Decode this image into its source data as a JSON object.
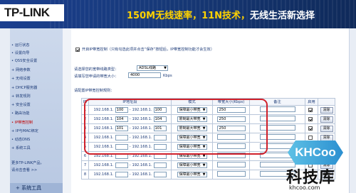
{
  "banner": {
    "brand": "TP-LINK",
    "tagline_speed": "150M无线速率，11N技术，",
    "tagline_rest": "无线生活新选择"
  },
  "sidebar": {
    "items": [
      {
        "label": "• 运行状态",
        "active": false
      },
      {
        "label": "• 设置向导",
        "active": false
      },
      {
        "label": "• QSS安全设置",
        "active": false
      },
      {
        "label": "+ 网络参数",
        "active": false
      },
      {
        "label": "+ 无线设置",
        "active": false
      },
      {
        "label": "+ DHCP服务器",
        "active": false
      },
      {
        "label": "+ 转发规则",
        "active": false
      },
      {
        "label": "+ 安全设置",
        "active": false
      },
      {
        "label": "• 路由功能",
        "active": false
      },
      {
        "label": "• IP带宽控制",
        "active": true
      },
      {
        "label": "+ IP与MAC绑定",
        "active": false
      },
      {
        "label": "• 动态DNS",
        "active": false
      },
      {
        "label": "+ 系统工具",
        "active": false
      }
    ],
    "more_1": "更多TP-LINK产品，",
    "more_2": "请点击查看 >>",
    "bottom_label": "+ 系统工具"
  },
  "main": {
    "enable_label": "开启IP带宽控制（只有勾选此项并点击“保存”按钮后，IP带宽控制功能才会生效）",
    "line_type_label": "请选择您的宽带线路类型：",
    "line_type_value": "ADSL线路",
    "bandwidth_label": "请填写您申请的带宽大小：",
    "bandwidth_value": "4000",
    "bandwidth_unit": "Kbps",
    "rules_label": "请配置IP带宽控制规则：",
    "columns": [
      "ID",
      "IP地址段",
      "模式",
      "带宽大小(Kbps)",
      "备注",
      "启用",
      ""
    ],
    "ip_prefix": "192.168.1.",
    "dash": "-",
    "clear_label": "清除",
    "rows": [
      {
        "id": "1",
        "start": "100",
        "end": "100",
        "mode": "保障最小带宽",
        "bw": "250",
        "enabled": true
      },
      {
        "id": "2",
        "start": "104",
        "end": "104",
        "mode": "限制最大带宽",
        "bw": "250",
        "enabled": true
      },
      {
        "id": "3",
        "start": "101",
        "end": "101",
        "mode": "限制最大带宽",
        "bw": "250",
        "enabled": true
      },
      {
        "id": "4",
        "start": "",
        "end": "",
        "mode": "保障最小带宽",
        "bw": "",
        "enabled": false
      },
      {
        "id": "5",
        "start": "",
        "end": "",
        "mode": "保障最小带宽",
        "bw": "",
        "enabled": false
      },
      {
        "id": "6",
        "start": "",
        "end": "",
        "mode": "保障最小带宽",
        "bw": "",
        "enabled": false
      },
      {
        "id": "7",
        "start": "",
        "end": "",
        "mode": "保障最小带宽",
        "bw": "",
        "enabled": false
      },
      {
        "id": "8",
        "start": "",
        "end": "",
        "mode": "保障最小带宽",
        "bw": "",
        "enabled": false
      }
    ]
  },
  "watermark": {
    "logo": "KHCoo",
    "name": "科技库",
    "url": "khcoo.com"
  },
  "colors": {
    "banner": "#173978",
    "sidebar": "#c3d2ea",
    "highlight_box": "#d0202a",
    "active_menu": "#c00000"
  }
}
